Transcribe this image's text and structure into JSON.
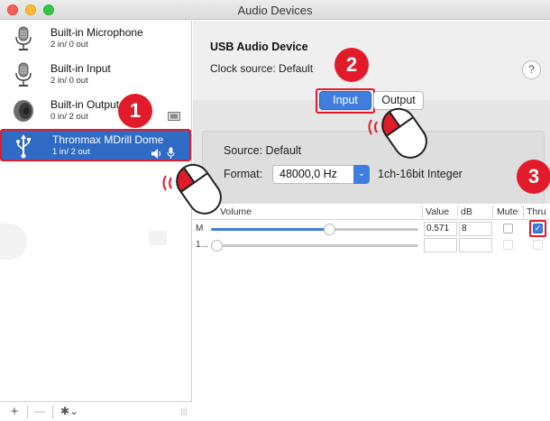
{
  "window": {
    "title": "Audio Devices"
  },
  "colors": {
    "accent": "#3f7ede",
    "selected": "#2f6bc4",
    "highlight_red": "#e21b2b"
  },
  "devices": [
    {
      "name": "Built-in Microphone",
      "io": "2 in/ 0 out",
      "icon": "microphone-icon"
    },
    {
      "name": "Built-in Input",
      "io": "2 in/ 0 out",
      "icon": "microphone-icon"
    },
    {
      "name": "Built-in Output",
      "io": "0 in/ 2 out",
      "icon": "speaker-icon"
    },
    {
      "name": "Thronmax MDrill Dome",
      "io": "1 in/ 2 out",
      "icon": "usb-icon",
      "selected": true
    }
  ],
  "sidebar_footer": {
    "add": "+",
    "remove": "—",
    "gear": "✱⌄",
    "resize": "|||"
  },
  "detail": {
    "device_title": "USB Audio Device",
    "clock_source": "Clock source:  Default",
    "help": "?",
    "tabs": {
      "input": "Input",
      "output": "Output",
      "active": "input"
    },
    "source": "Source:  Default",
    "format_label": "Format:",
    "format_value": "48000,0 Hz",
    "format_desc": "1ch-16bit Integer"
  },
  "table": {
    "headers": {
      "volume": "Volume",
      "value": "Value",
      "db": "dB",
      "mute": "Mute",
      "thru": "Thru"
    },
    "rows": [
      {
        "label": "M",
        "value": "0.571",
        "db": "8",
        "mute": false,
        "thru": true,
        "level": 0.571
      },
      {
        "label": "1...",
        "value": "",
        "db": "",
        "mute": false,
        "thru": false,
        "level": 0.0
      }
    ]
  },
  "steps": [
    "1",
    "2",
    "3"
  ]
}
